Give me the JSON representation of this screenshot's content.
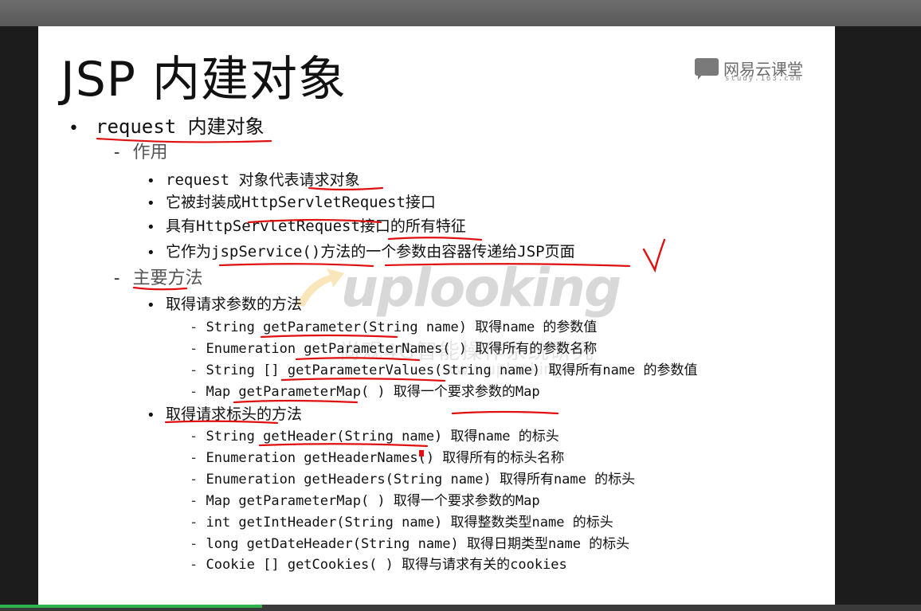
{
  "slide": {
    "title": "JSP 内建对象",
    "logo": {
      "name": "网易云课堂",
      "sub": "study.163.com"
    },
    "sections": {
      "request": "request 内建对象",
      "purpose_heading": "作用",
      "purpose": [
        "request 对象代表请求对象",
        "它被封装成HttpServletRequest接口",
        "具有HttpServletRequest接口的所有特征",
        "它作为jspService()方法的一个参数由容器传递给JSP页面"
      ],
      "methods_heading": "主要方法",
      "param_heading": "取得请求参数的方法",
      "param_methods": [
        "String getParameter(String name) 取得name 的参数值",
        "Enumeration getParameterNames( ) 取得所有的参数名称",
        "String [] getParameterValues(String name) 取得所有name 的参数值",
        "Map getParameterMap( ) 取得一个要求参数的Map"
      ],
      "header_heading": "取得请求标头的方法",
      "header_methods": [
        "String getHeader(String name) 取得name 的标头",
        "Enumeration getHeaderNames() 取得所有的标头名称",
        "Enumeration getHeaders(String name) 取得所有name 的标头",
        "Map getParameterMap( ) 取得一个要求参数的Map",
        "int getIntHeader(String name) 取得整数类型name 的标头",
        "long getDateHeader(String name) 取得日期类型name 的标头",
        "Cookie [] getCookies( ) 取得与请求有关的cookies"
      ]
    },
    "watermark": {
      "brand": "uplooking",
      "tagline": "尚观4G智能操作系统研究",
      "url": "www.uplooking.com"
    },
    "annotation": "✓"
  },
  "player": {
    "progress_fraction": 0.285
  },
  "colors": {
    "ink": "#e01010",
    "slide_bg": "#ffffff",
    "progress": "#2bb24c"
  }
}
